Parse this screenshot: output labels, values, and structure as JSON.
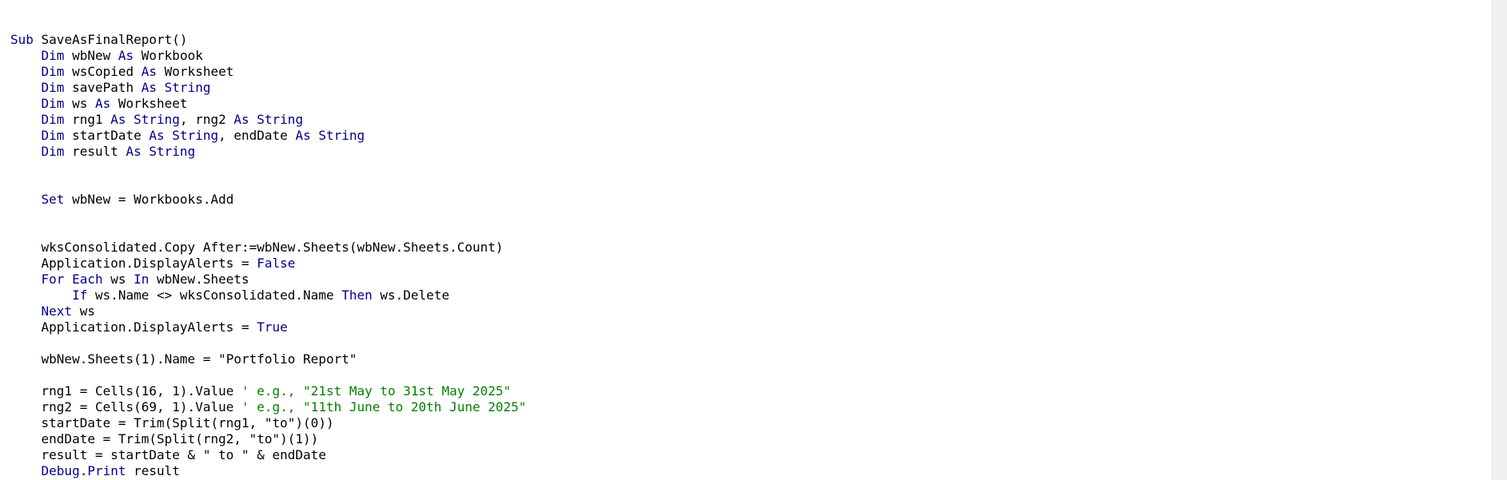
{
  "colors": {
    "background": "#ffffff",
    "text": "#000000",
    "keyword": "#00008b",
    "comment": "#008000",
    "scrollbar": "#f0f0f0"
  },
  "code": [
    [
      {
        "t": "Sub",
        "k": "kw"
      },
      {
        "t": " SaveAsFinalReport()",
        "k": "tx"
      }
    ],
    [
      {
        "t": "    ",
        "k": "tx"
      },
      {
        "t": "Dim",
        "k": "kw"
      },
      {
        "t": " wbNew ",
        "k": "tx"
      },
      {
        "t": "As",
        "k": "kw"
      },
      {
        "t": " Workbook",
        "k": "tx"
      }
    ],
    [
      {
        "t": "    ",
        "k": "tx"
      },
      {
        "t": "Dim",
        "k": "kw"
      },
      {
        "t": " wsCopied ",
        "k": "tx"
      },
      {
        "t": "As",
        "k": "kw"
      },
      {
        "t": " Worksheet",
        "k": "tx"
      }
    ],
    [
      {
        "t": "    ",
        "k": "tx"
      },
      {
        "t": "Dim",
        "k": "kw"
      },
      {
        "t": " savePath ",
        "k": "tx"
      },
      {
        "t": "As String",
        "k": "kw"
      }
    ],
    [
      {
        "t": "    ",
        "k": "tx"
      },
      {
        "t": "Dim",
        "k": "kw"
      },
      {
        "t": " ws ",
        "k": "tx"
      },
      {
        "t": "As",
        "k": "kw"
      },
      {
        "t": " Worksheet",
        "k": "tx"
      }
    ],
    [
      {
        "t": "    ",
        "k": "tx"
      },
      {
        "t": "Dim",
        "k": "kw"
      },
      {
        "t": " rng1 ",
        "k": "tx"
      },
      {
        "t": "As String",
        "k": "kw"
      },
      {
        "t": ", rng2 ",
        "k": "tx"
      },
      {
        "t": "As String",
        "k": "kw"
      }
    ],
    [
      {
        "t": "    ",
        "k": "tx"
      },
      {
        "t": "Dim",
        "k": "kw"
      },
      {
        "t": " startDate ",
        "k": "tx"
      },
      {
        "t": "As String",
        "k": "kw"
      },
      {
        "t": ", endDate ",
        "k": "tx"
      },
      {
        "t": "As String",
        "k": "kw"
      }
    ],
    [
      {
        "t": "    ",
        "k": "tx"
      },
      {
        "t": "Dim",
        "k": "kw"
      },
      {
        "t": " result ",
        "k": "tx"
      },
      {
        "t": "As String",
        "k": "kw"
      }
    ],
    [],
    [],
    [
      {
        "t": "    ",
        "k": "tx"
      },
      {
        "t": "Set",
        "k": "kw"
      },
      {
        "t": " wbNew = Workbooks.Add",
        "k": "tx"
      }
    ],
    [],
    [],
    [
      {
        "t": "    wksConsolidated.Copy After:=wbNew.Sheets(wbNew.Sheets.Count)",
        "k": "tx"
      }
    ],
    [
      {
        "t": "    Application.DisplayAlerts = ",
        "k": "tx"
      },
      {
        "t": "False",
        "k": "kw"
      }
    ],
    [
      {
        "t": "    ",
        "k": "tx"
      },
      {
        "t": "For Each",
        "k": "kw"
      },
      {
        "t": " ws ",
        "k": "tx"
      },
      {
        "t": "In",
        "k": "kw"
      },
      {
        "t": " wbNew.Sheets",
        "k": "tx"
      }
    ],
    [
      {
        "t": "        ",
        "k": "tx"
      },
      {
        "t": "If",
        "k": "kw"
      },
      {
        "t": " ws.Name <> wksConsolidated.Name ",
        "k": "tx"
      },
      {
        "t": "Then",
        "k": "kw"
      },
      {
        "t": " ws.Delete",
        "k": "tx"
      }
    ],
    [
      {
        "t": "    ",
        "k": "tx"
      },
      {
        "t": "Next",
        "k": "kw"
      },
      {
        "t": " ws",
        "k": "tx"
      }
    ],
    [
      {
        "t": "    Application.DisplayAlerts = ",
        "k": "tx"
      },
      {
        "t": "True",
        "k": "kw"
      }
    ],
    [],
    [
      {
        "t": "    wbNew.Sheets(1).Name = \"Portfolio Report\"",
        "k": "tx"
      }
    ],
    [],
    [
      {
        "t": "    rng1 = Cells(16, 1).Value ",
        "k": "tx"
      },
      {
        "t": "' e.g., \"21st May to 31st May 2025\"",
        "k": "cm"
      }
    ],
    [
      {
        "t": "    rng2 = Cells(69, 1).Value ",
        "k": "tx"
      },
      {
        "t": "' e.g., \"11th June to 20th June 2025\"",
        "k": "cm"
      }
    ],
    [
      {
        "t": "    startDate = Trim(Split(rng1, \"to\")(0))",
        "k": "tx"
      }
    ],
    [
      {
        "t": "    endDate = Trim(Split(rng2, \"to\")(1))",
        "k": "tx"
      }
    ],
    [
      {
        "t": "    result = startDate & \" to \" & endDate",
        "k": "tx"
      }
    ],
    [
      {
        "t": "    ",
        "k": "tx"
      },
      {
        "t": "Debug",
        "k": "kw"
      },
      {
        "t": ".",
        "k": "tx"
      },
      {
        "t": "Print",
        "k": "kw"
      },
      {
        "t": " result",
        "k": "tx"
      }
    ]
  ]
}
